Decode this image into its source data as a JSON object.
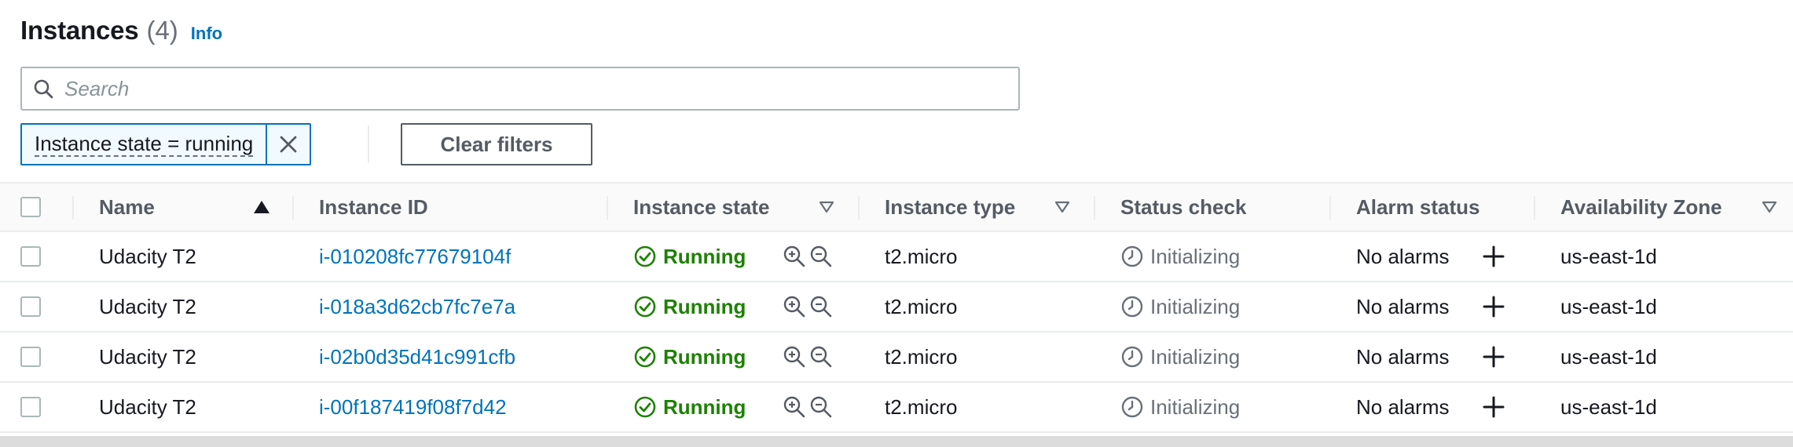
{
  "header": {
    "title": "Instances",
    "count": "(4)",
    "info": "Info"
  },
  "search": {
    "placeholder": "Search",
    "value": ""
  },
  "filter": {
    "token": "Instance state = running",
    "clear_label": "Clear filters"
  },
  "table": {
    "columns": {
      "name": "Name",
      "instance_id": "Instance ID",
      "instance_state": "Instance state",
      "instance_type": "Instance type",
      "status_check": "Status check",
      "alarm_status": "Alarm status",
      "availability_zone": "Availability Zone"
    },
    "rows": [
      {
        "name": "Udacity T2",
        "id": "i-010208fc77679104f",
        "state": "Running",
        "type": "t2.micro",
        "status": "Initializing",
        "alarm": "No alarms",
        "az": "us-east-1d"
      },
      {
        "name": "Udacity T2",
        "id": "i-018a3d62cb7fc7e7a",
        "state": "Running",
        "type": "t2.micro",
        "status": "Initializing",
        "alarm": "No alarms",
        "az": "us-east-1d"
      },
      {
        "name": "Udacity T2",
        "id": "i-02b0d35d41c991cfb",
        "state": "Running",
        "type": "t2.micro",
        "status": "Initializing",
        "alarm": "No alarms",
        "az": "us-east-1d"
      },
      {
        "name": "Udacity T2",
        "id": "i-00f187419f08f7d42",
        "state": "Running",
        "type": "t2.micro",
        "status": "Initializing",
        "alarm": "No alarms",
        "az": "us-east-1d"
      }
    ]
  },
  "icons": {
    "search": "search-icon",
    "close": "close-icon",
    "sort_asc": "sort-ascending-icon",
    "filter_col": "caret-down-icon",
    "running": "check-circle-icon",
    "zoom_in": "zoom-in-icon",
    "zoom_out": "zoom-out-icon",
    "pending": "clock-icon",
    "add": "plus-icon"
  },
  "colors": {
    "link": "#0073bb",
    "running": "#1d8102",
    "muted": "#687078",
    "border": "#eaeded"
  }
}
